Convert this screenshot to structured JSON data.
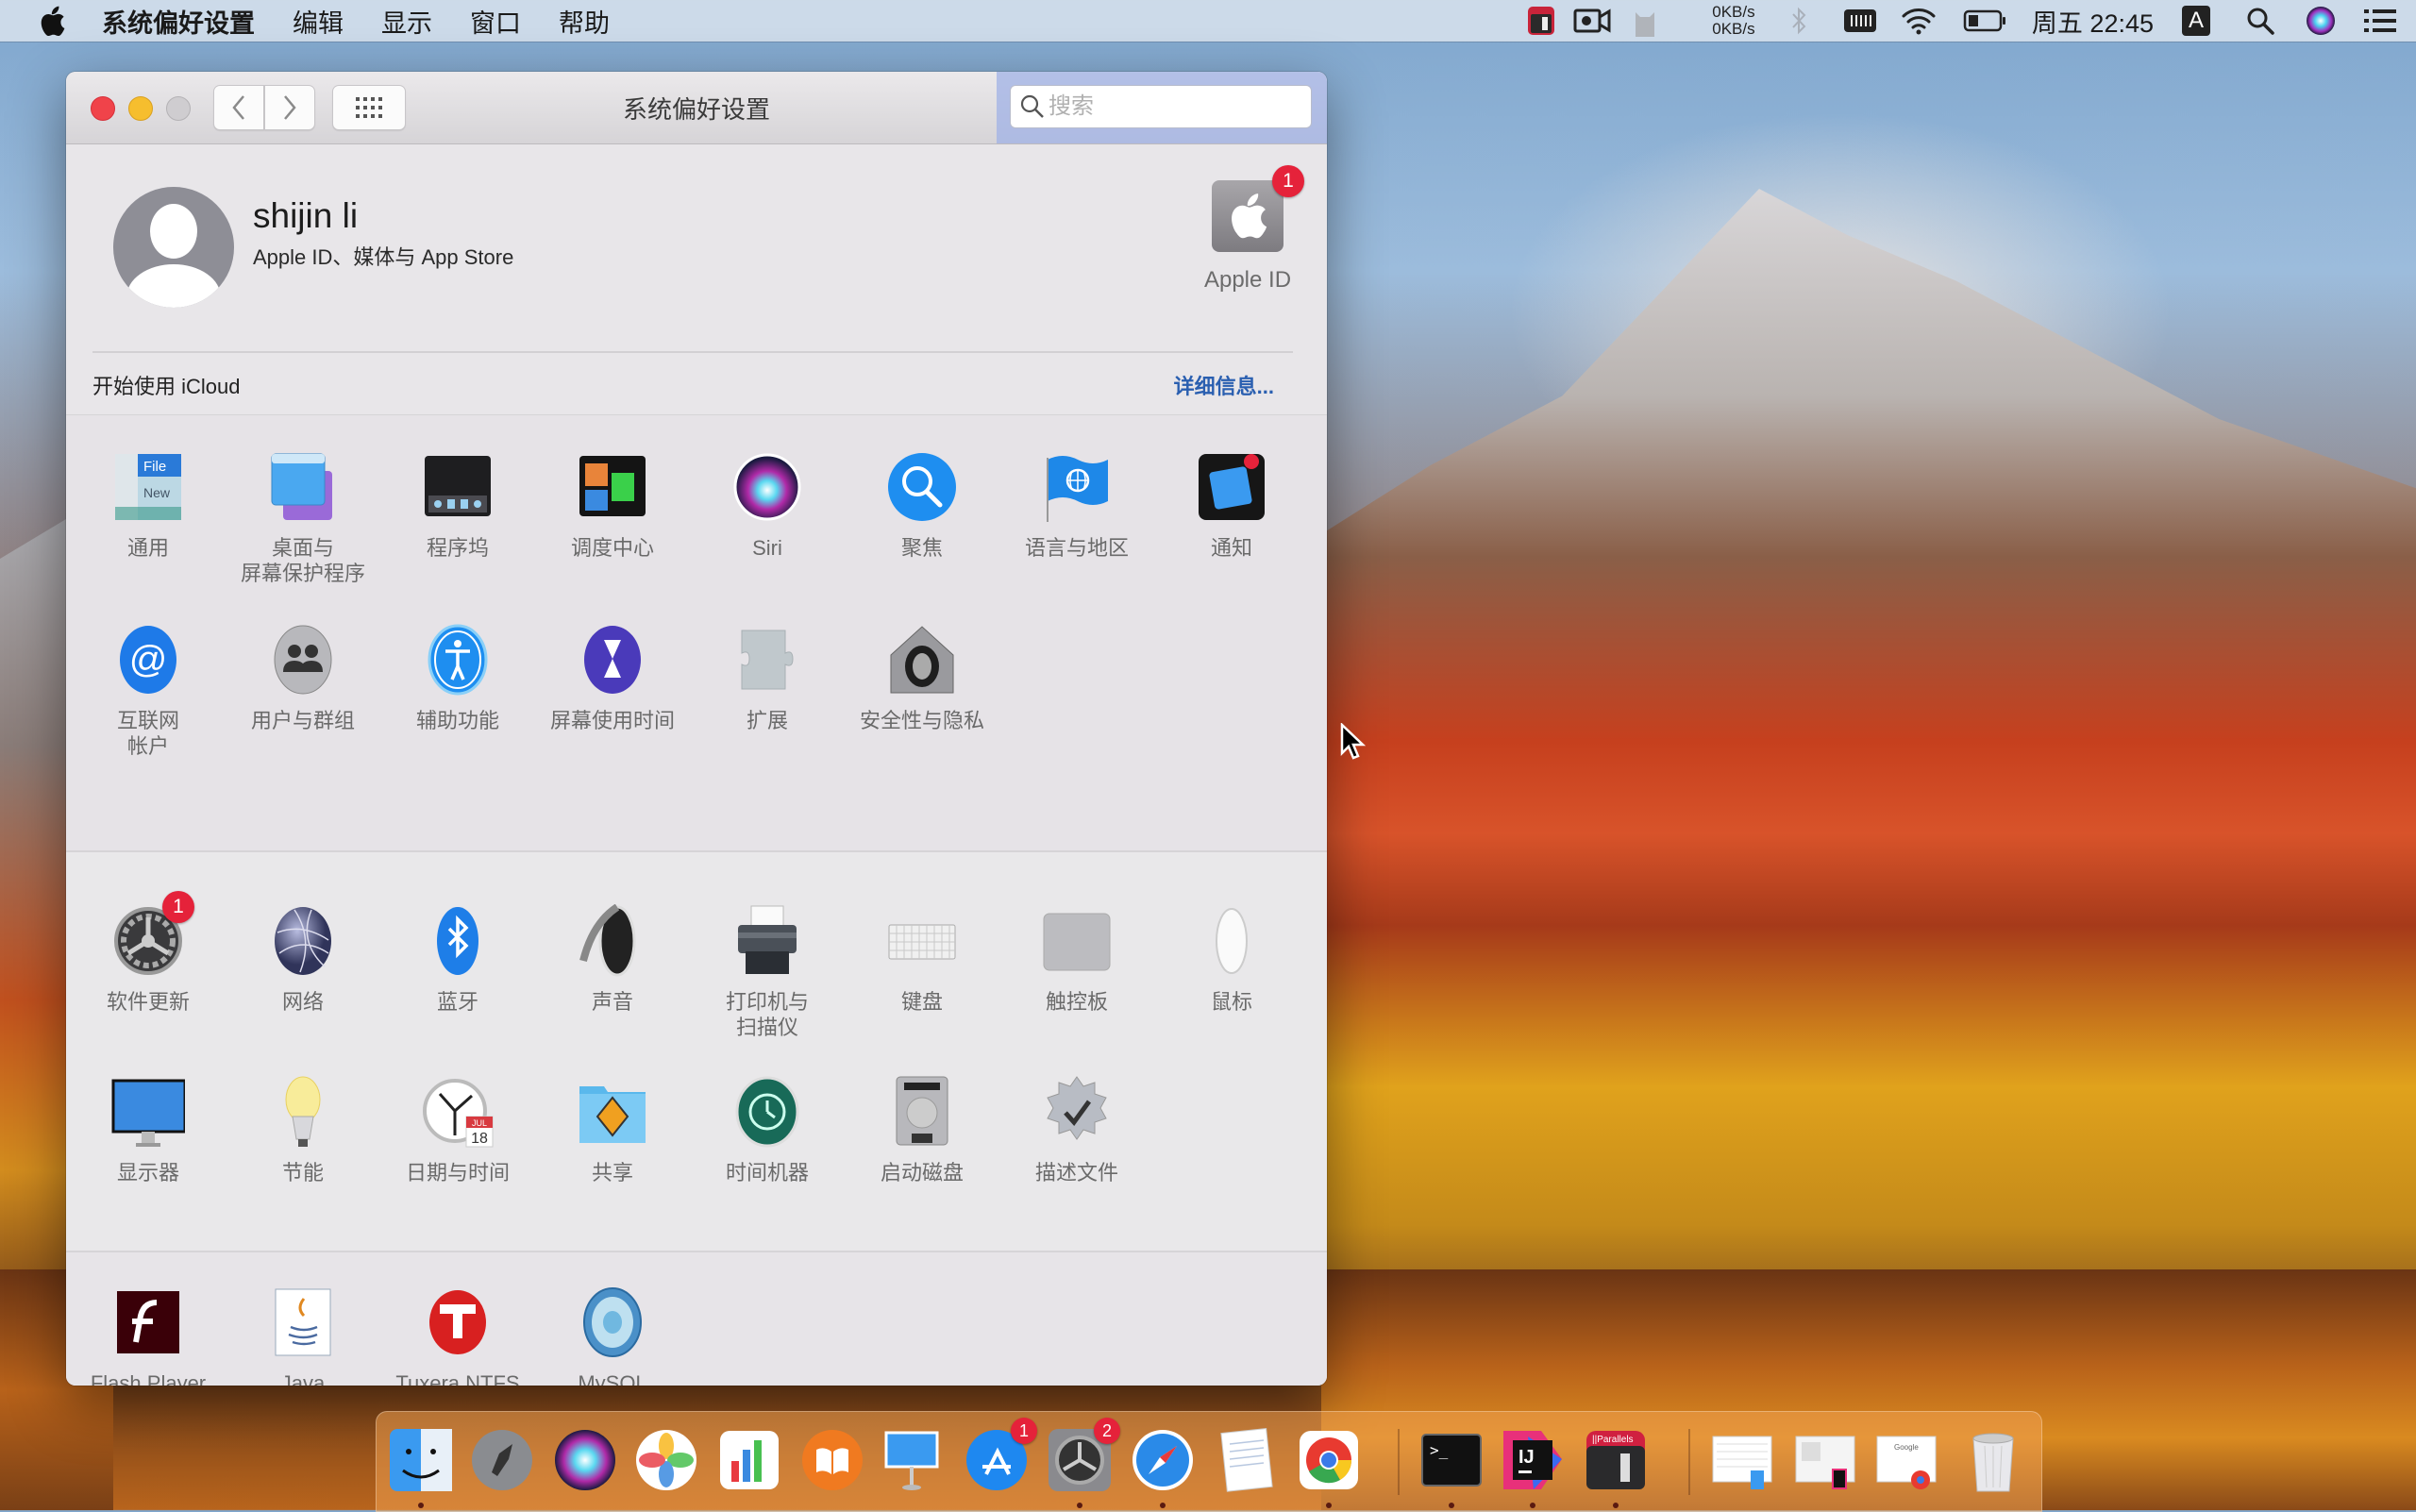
{
  "menubar": {
    "app_name": "系统偏好设置",
    "menus": [
      "编辑",
      "显示",
      "窗口",
      "帮助"
    ],
    "status": {
      "net_up": "0KB/s",
      "net_down": "0KB/s",
      "clock": "周五 22:45",
      "input_method": "A",
      "icons": [
        "parallels-icon",
        "screen-record-icon",
        "cat-icon",
        "network-speed",
        "bluetooth-icon",
        "keyboard-brightness-icon",
        "wifi-icon",
        "battery-icon",
        "clock",
        "input-method-icon",
        "spotlight-icon",
        "siri-icon",
        "notification-center-icon"
      ]
    }
  },
  "window": {
    "title": "系统偏好设置",
    "search": {
      "placeholder": "搜索",
      "value": ""
    },
    "account": {
      "name": "shijin li",
      "subtitle": "Apple ID、媒体与 App Store",
      "appleid_label": "Apple ID",
      "appleid_badge": "1",
      "icloud_prompt": "开始使用 iCloud",
      "details_link": "详细信息..."
    },
    "sections": [
      {
        "name": "personal",
        "panes": [
          {
            "label": "通用",
            "icon": "general-icon"
          },
          {
            "label": "桌面与\n屏幕保护程序",
            "icon": "desktop-screensaver-icon"
          },
          {
            "label": "程序坞",
            "icon": "dock-icon"
          },
          {
            "label": "调度中心",
            "icon": "mission-control-icon"
          },
          {
            "label": "Siri",
            "icon": "siri-icon"
          },
          {
            "label": "聚焦",
            "icon": "spotlight-icon"
          },
          {
            "label": "语言与地区",
            "icon": "language-region-icon"
          },
          {
            "label": "通知",
            "icon": "notifications-icon"
          },
          {
            "label": "互联网\n帐户",
            "icon": "internet-accounts-icon"
          },
          {
            "label": "用户与群组",
            "icon": "users-groups-icon"
          },
          {
            "label": "辅助功能",
            "icon": "accessibility-icon"
          },
          {
            "label": "屏幕使用时间",
            "icon": "screen-time-icon"
          },
          {
            "label": "扩展",
            "icon": "extensions-icon"
          },
          {
            "label": "安全性与隐私",
            "icon": "security-privacy-icon"
          }
        ]
      },
      {
        "name": "hardware",
        "panes": [
          {
            "label": "软件更新",
            "icon": "software-update-icon",
            "badge": "1"
          },
          {
            "label": "网络",
            "icon": "network-icon"
          },
          {
            "label": "蓝牙",
            "icon": "bluetooth-icon"
          },
          {
            "label": "声音",
            "icon": "sound-icon"
          },
          {
            "label": "打印机与\n扫描仪",
            "icon": "printer-scanner-icon"
          },
          {
            "label": "键盘",
            "icon": "keyboard-icon"
          },
          {
            "label": "触控板",
            "icon": "trackpad-icon"
          },
          {
            "label": "鼠标",
            "icon": "mouse-icon"
          },
          {
            "label": "显示器",
            "icon": "displays-icon"
          },
          {
            "label": "节能",
            "icon": "energy-saver-icon"
          },
          {
            "label": "日期与时间",
            "icon": "date-time-icon"
          },
          {
            "label": "共享",
            "icon": "sharing-icon"
          },
          {
            "label": "时间机器",
            "icon": "time-machine-icon"
          },
          {
            "label": "启动磁盘",
            "icon": "startup-disk-icon"
          },
          {
            "label": "描述文件",
            "icon": "profiles-icon"
          }
        ]
      },
      {
        "name": "other",
        "panes": [
          {
            "label": "Flash Player",
            "icon": "flash-player-icon"
          },
          {
            "label": "Java",
            "icon": "java-icon"
          },
          {
            "label": "Tuxera NTFS",
            "icon": "tuxera-ntfs-icon"
          },
          {
            "label": "MySQL",
            "icon": "mysql-icon"
          }
        ]
      }
    ]
  },
  "dock": {
    "items": [
      {
        "name": "finder",
        "running": true
      },
      {
        "name": "launchpad",
        "running": false
      },
      {
        "name": "siri",
        "running": false
      },
      {
        "name": "photos",
        "running": false
      },
      {
        "name": "numbers",
        "running": false
      },
      {
        "name": "books",
        "running": false
      },
      {
        "name": "keynote",
        "running": false
      },
      {
        "name": "app-store",
        "running": false,
        "badge": "1"
      },
      {
        "name": "system-preferences",
        "running": true,
        "badge": "2"
      },
      {
        "name": "safari",
        "running": true
      },
      {
        "name": "textedit",
        "running": false
      },
      {
        "name": "chrome",
        "running": true
      },
      {
        "name": "terminal",
        "running": true
      },
      {
        "name": "intellij-idea",
        "running": true
      },
      {
        "name": "parallels",
        "running": true
      },
      {
        "name": "minimized-window-finder",
        "running": false
      },
      {
        "name": "minimized-window-idea",
        "running": false
      },
      {
        "name": "minimized-window-chrome",
        "running": false
      },
      {
        "name": "trash",
        "running": false
      }
    ],
    "parallels_label": "||Parallels"
  },
  "colors": {
    "accent_link": "#2a5fb0",
    "badge": "#e5223a",
    "close": "#f0434a",
    "minimize": "#f6be2e"
  }
}
